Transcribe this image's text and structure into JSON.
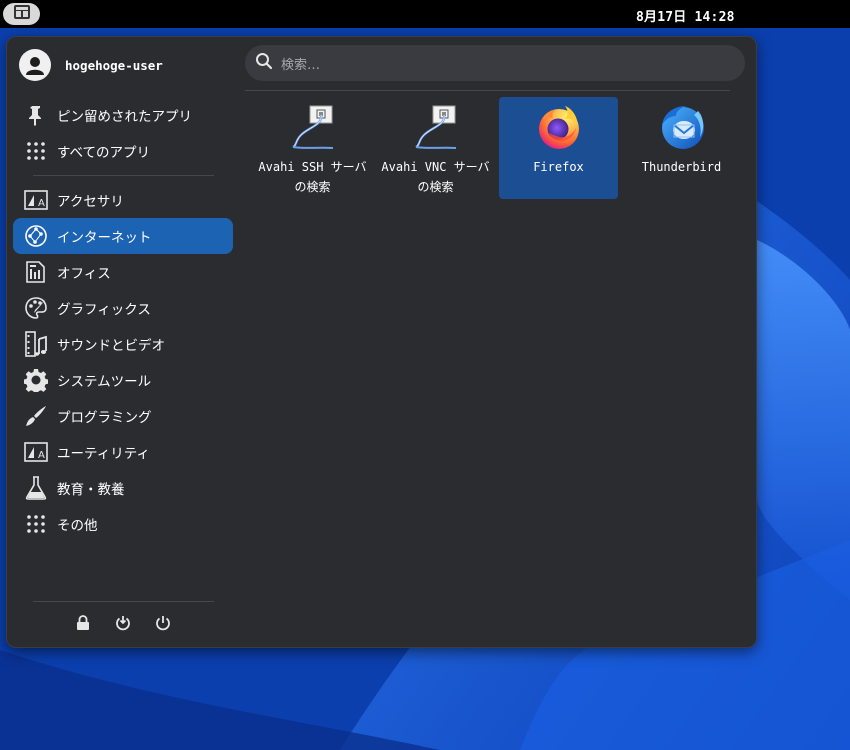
{
  "panel": {
    "clock": "8月17日  14:28",
    "launcher_icon": "menu-grid-icon"
  },
  "menu": {
    "user": {
      "name": "hogehoge-user",
      "avatar_icon": "user-avatar-icon"
    },
    "search": {
      "placeholder": "検索…",
      "icon": "search-icon"
    },
    "sidebar": {
      "items": [
        {
          "label": "ピン留めされたアプリ",
          "icon": "pin-icon"
        },
        {
          "label": "すべてのアプリ",
          "icon": "grid-dots-icon"
        },
        {
          "label": "アクセサリ",
          "icon": "accessories-icon"
        },
        {
          "label": "インターネット",
          "icon": "internet-globe-icon",
          "active": true
        },
        {
          "label": "オフィス",
          "icon": "office-icon"
        },
        {
          "label": "グラフィックス",
          "icon": "graphics-palette-icon"
        },
        {
          "label": "サウンドとビデオ",
          "icon": "sound-video-icon"
        },
        {
          "label": "システムツール",
          "icon": "gear-icon"
        },
        {
          "label": "プログラミング",
          "icon": "programming-brush-icon"
        },
        {
          "label": "ユーティリティ",
          "icon": "utilities-icon"
        },
        {
          "label": "教育・教養",
          "icon": "flask-icon"
        },
        {
          "label": "その他",
          "icon": "grid-dots-icon"
        }
      ]
    },
    "session_buttons": [
      "lock-icon",
      "logout-icon",
      "power-icon"
    ],
    "apps": [
      {
        "label": "Avahi SSH サーバの検索",
        "icon": "network-cable-icon"
      },
      {
        "label": "Avahi VNC サーバの検索",
        "icon": "network-cable-icon"
      },
      {
        "label": "Firefox",
        "icon": "firefox-icon",
        "selected": true
      },
      {
        "label": "Thunderbird",
        "icon": "thunderbird-icon"
      }
    ]
  },
  "colors": {
    "menu_bg": "#2b2c30",
    "active_item": "#1c64b3",
    "selected_tile": "#1c4e93",
    "panel_bg": "#000000"
  }
}
